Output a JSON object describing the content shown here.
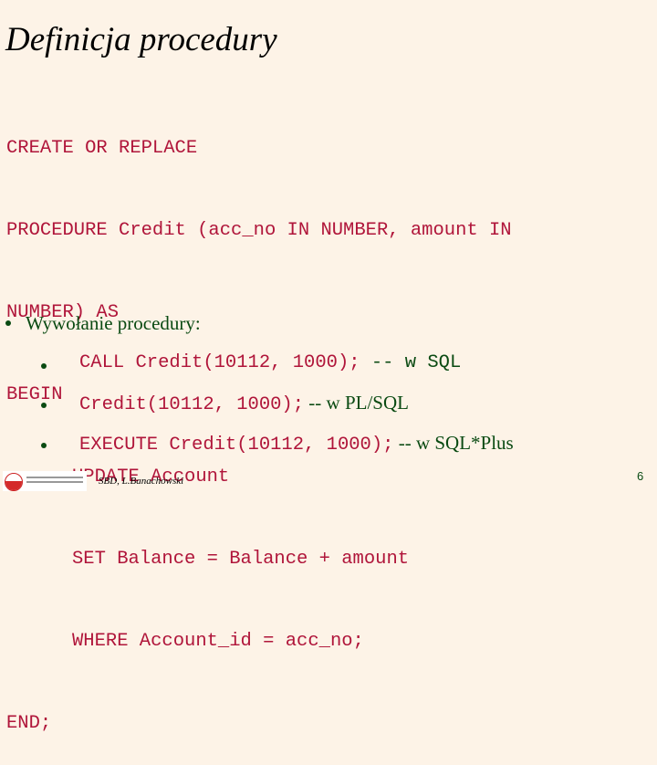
{
  "slide": {
    "title": "Definicja procedury",
    "code_lines": [
      {
        "text": "CREATE OR REPLACE",
        "indent": false
      },
      {
        "text": "PROCEDURE Credit (acc_no IN NUMBER, amount IN",
        "indent": false
      },
      {
        "text": "NUMBER) AS",
        "indent": false
      },
      {
        "text": "BEGIN",
        "indent": false
      },
      {
        "text": "UPDATE Account",
        "indent": true
      },
      {
        "text": "SET Balance = Balance + amount",
        "indent": true
      },
      {
        "text": "WHERE Account_id = acc_no;",
        "indent": true
      },
      {
        "text": "END;",
        "indent": false
      }
    ],
    "bullet_heading": "Wywołanie procedury:",
    "sub_bullets": [
      {
        "code": "CALL Credit(10112, 1000);",
        "comment": " -- w SQL",
        "comment_style": "mono"
      },
      {
        "code": "Credit(10112, 1000);",
        "comment": " -- w PL/SQL",
        "comment_style": "serif"
      },
      {
        "code": "EXECUTE Credit(10112, 1000);",
        "comment": " -- w SQL*Plus",
        "comment_style": "serif"
      }
    ]
  },
  "footer": {
    "logo_icon": "university-logo-icon",
    "author": "SBD, L.Banachowski",
    "page_number": "6"
  },
  "colors": {
    "background": "#fdf3e7",
    "code": "#b0153a",
    "text_green": "#0a4a12"
  }
}
